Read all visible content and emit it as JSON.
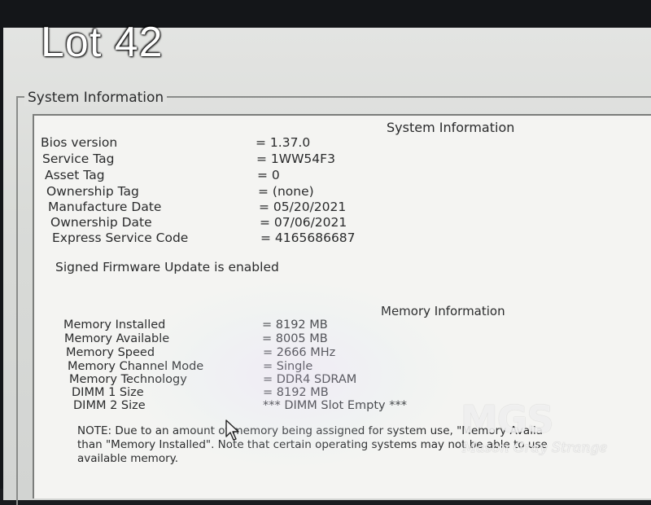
{
  "overlay": {
    "lot_label": "Lot 42"
  },
  "group": {
    "legend": "System Information"
  },
  "system_info": {
    "title": "System Information",
    "rows": [
      {
        "label": "Bios version",
        "value": "= 1.37.0"
      },
      {
        "label": "Service Tag",
        "value": "= 1WW54F3"
      },
      {
        "label": "Asset Tag",
        "value": "= 0"
      },
      {
        "label": "Ownership Tag",
        "value": "= (none)"
      },
      {
        "label": "Manufacture Date",
        "value": "= 05/20/2021"
      },
      {
        "label": "Ownership Date",
        "value": "= 07/06/2021"
      },
      {
        "label": "Express Service Code",
        "value": "= 4165686687"
      }
    ],
    "firmware_status": "Signed Firmware Update is enabled"
  },
  "memory_info": {
    "title": "Memory Information",
    "rows": [
      {
        "label": "Memory Installed",
        "value": "= 8192 MB"
      },
      {
        "label": "Memory Available",
        "value": "= 8005 MB"
      },
      {
        "label": "Memory Speed",
        "value": "= 2666 MHz"
      },
      {
        "label": "Memory Channel Mode",
        "value": "= Single"
      },
      {
        "label": "Memory Technology",
        "value": "= DDR4 SDRAM"
      },
      {
        "label": "DIMM 1 Size",
        "value": "= 8192 MB"
      },
      {
        "label": "DIMM 2 Size",
        "value": "*** DIMM Slot Empty ***"
      }
    ],
    "note": "NOTE: Due to an amount of memory being assigned for system use, \"Memory Availa\nthan \"Memory Installed\". Note that certain operating systems may not be able to use\navailable memory."
  },
  "watermark": {
    "logo": "MGS",
    "subtitle": "Mason Gray Strange"
  },
  "icons": {
    "cursor": "mouse-pointer-icon"
  }
}
